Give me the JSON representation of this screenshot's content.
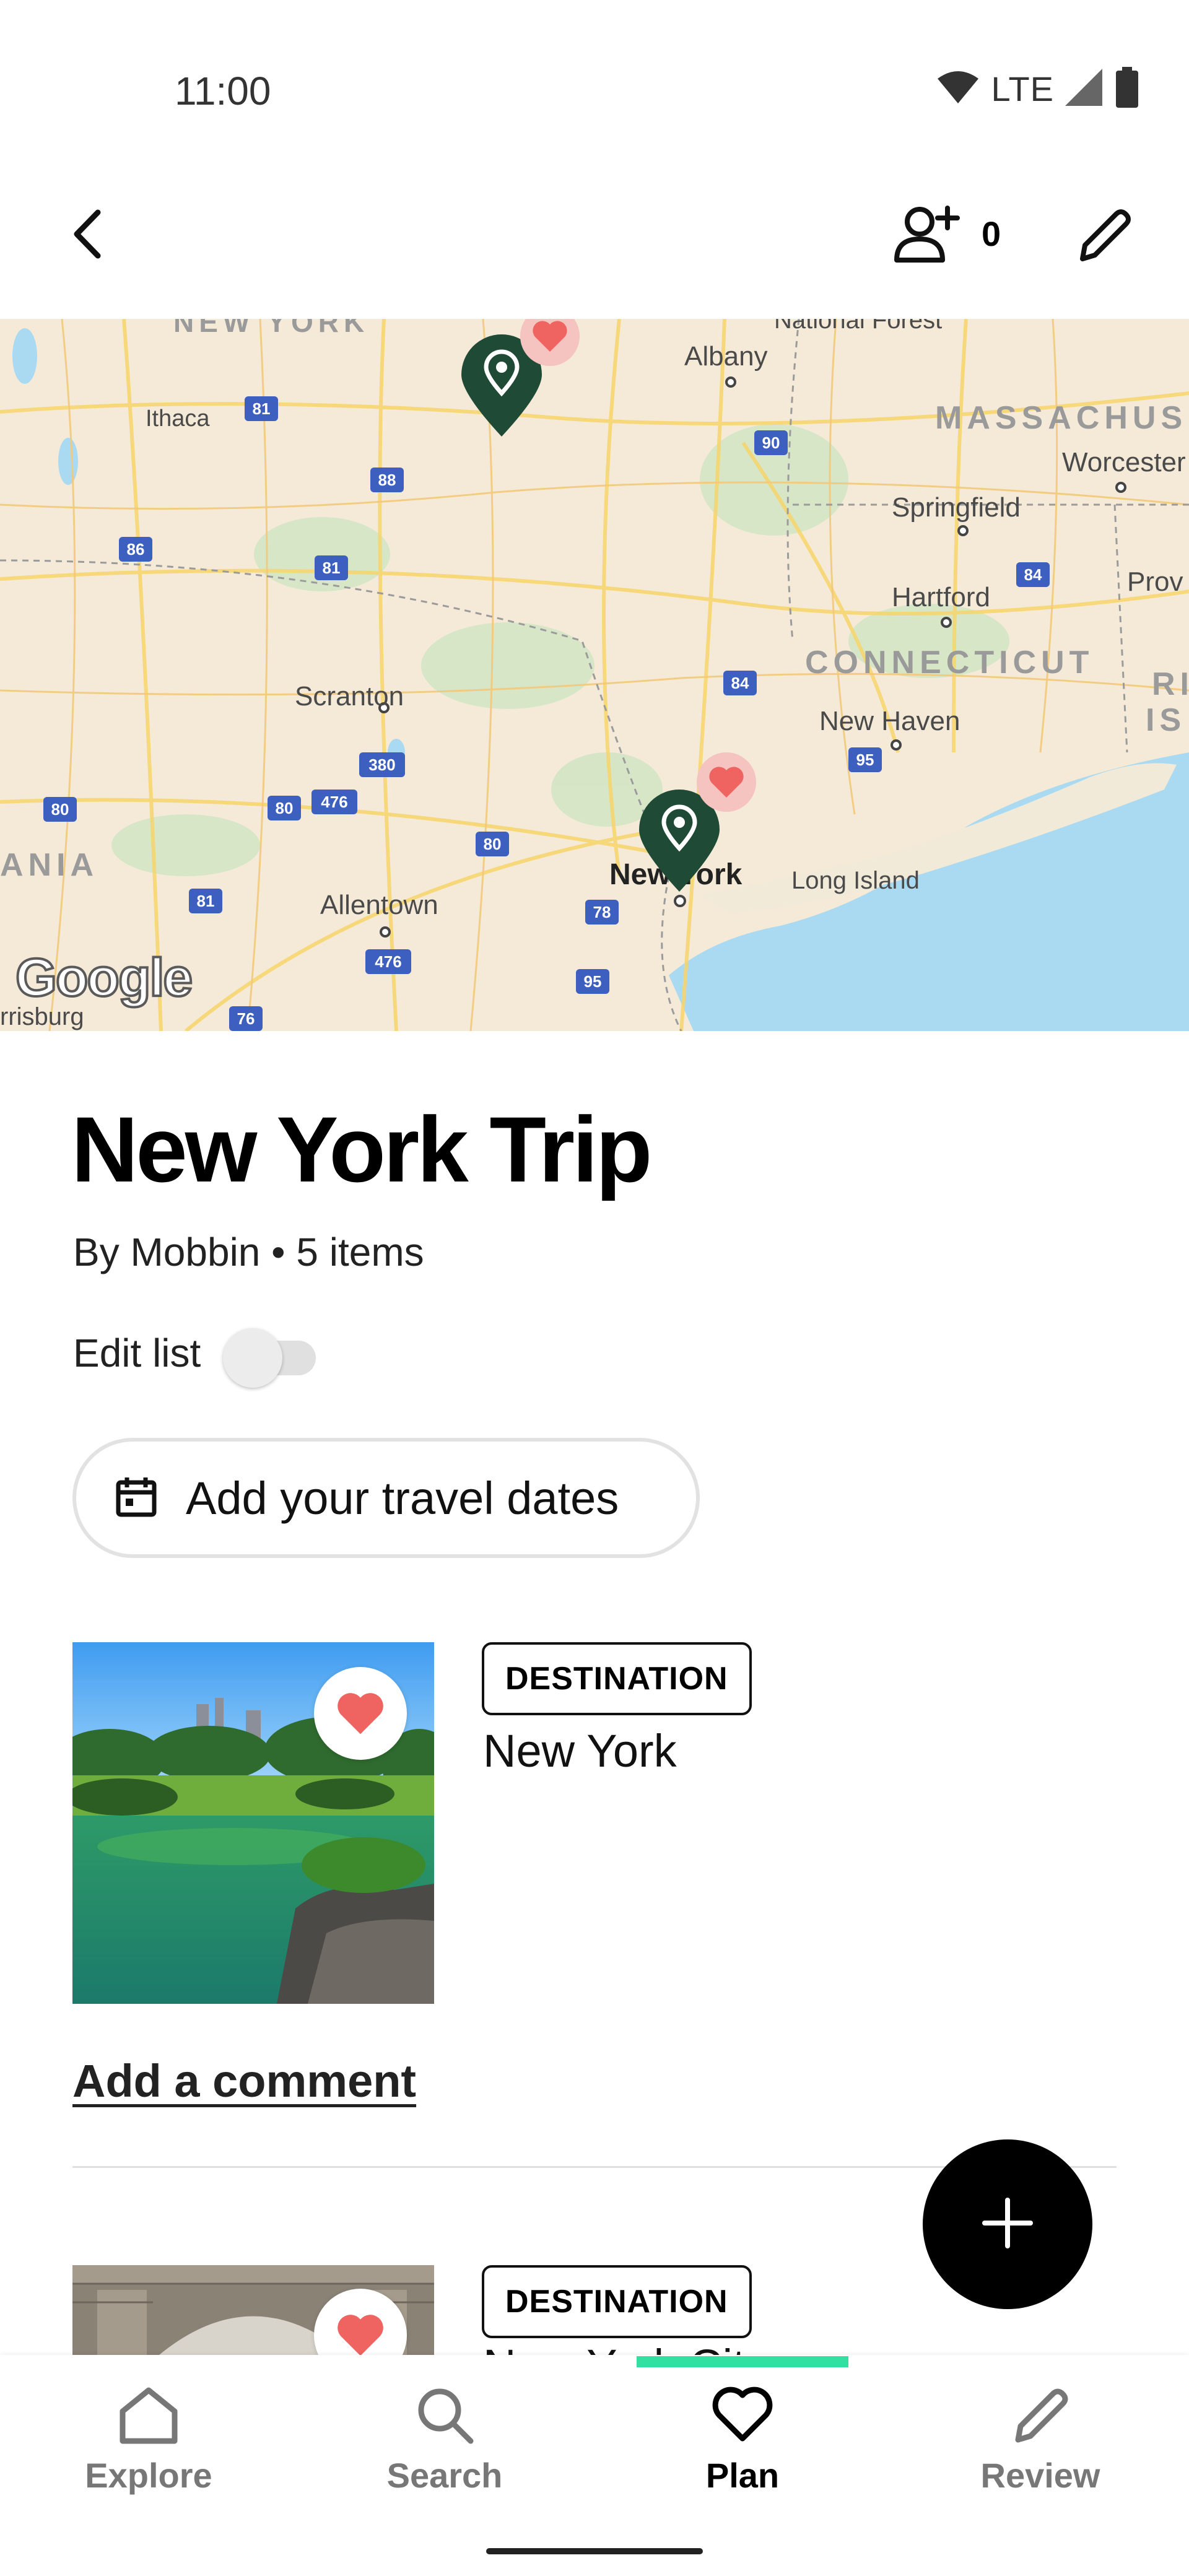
{
  "status_bar": {
    "time": "11:00",
    "network": "LTE",
    "icons": [
      "wifi-icon",
      "signal-icon",
      "battery-icon"
    ]
  },
  "top_nav": {
    "back_icon": "chevron-left-icon",
    "invite_icon": "add-person-icon",
    "invite_count": "0",
    "edit_icon": "pencil-icon"
  },
  "map": {
    "labels": {
      "new_york_state": "NEW YORK",
      "national_forest": "National Forest",
      "albany": "Albany",
      "massachusetts": "MASSACHUS",
      "worcester": "Worcester",
      "ithaca": "Ithaca",
      "springfield": "Springfield",
      "hartford": "Hartford",
      "providence": "Prov",
      "connecticut": "CONNECTICUT",
      "rhode_island_1": "RI",
      "rhode_island_2": "IS",
      "scranton": "Scranton",
      "new_haven": "New Haven",
      "pennsylvania": "ANIA",
      "allentown": "Allentown",
      "new_york_city": "New York",
      "long_island": "Long Island",
      "harrisburg": "rrisburg"
    },
    "highway_shields": [
      "81",
      "88",
      "90",
      "86",
      "81",
      "84",
      "84",
      "380",
      "95",
      "80",
      "80",
      "476",
      "80",
      "81",
      "78",
      "476",
      "95",
      "76"
    ],
    "attribution": "Google",
    "pin_icon": "map-pin-icon",
    "heart_icon": "heart-icon"
  },
  "trip": {
    "title": "New York Trip",
    "meta": "By Mobbin • 5 items",
    "edit_list_label": "Edit list",
    "edit_list_on": false,
    "dates_button": "Add your travel dates",
    "dates_icon": "calendar-icon"
  },
  "items": [
    {
      "badge": "DESTINATION",
      "name": "New York",
      "saved": true,
      "add_comment": "Add a comment"
    },
    {
      "badge": "DESTINATION",
      "name": "New York City",
      "saved": true
    }
  ],
  "fab_icon": "plus-icon",
  "bottom_nav": {
    "items": [
      {
        "label": "Explore",
        "icon": "home-icon",
        "active": false
      },
      {
        "label": "Search",
        "icon": "search-icon",
        "active": false
      },
      {
        "label": "Plan",
        "icon": "heart-icon",
        "active": true
      },
      {
        "label": "Review",
        "icon": "pencil-icon",
        "active": false
      }
    ]
  },
  "colors": {
    "accent": "#34e0a1",
    "pin": "#1f4a36",
    "heart": "#ef6461",
    "water": "#aadaf1",
    "land": "#f4ead7"
  }
}
